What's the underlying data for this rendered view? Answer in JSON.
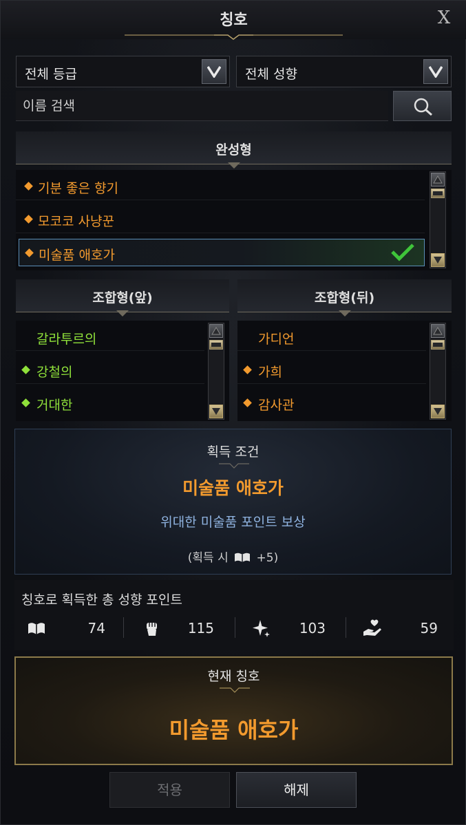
{
  "window": {
    "title": "칭호",
    "close_label": "X"
  },
  "filters": {
    "grade": {
      "selected": "전체 등급"
    },
    "tendency": {
      "selected": "전체 성향"
    }
  },
  "search": {
    "placeholder": "이름 검색"
  },
  "complete": {
    "header": "완성형",
    "items": [
      {
        "label": "기분 좋은 향기",
        "color": "#f29a2e",
        "bullet": true,
        "selected": false
      },
      {
        "label": "모코코 사냥꾼",
        "color": "#f29a2e",
        "bullet": true,
        "selected": false
      },
      {
        "label": "미술품 애호가",
        "color": "#f29a2e",
        "bullet": true,
        "selected": true
      }
    ]
  },
  "combo_front": {
    "header": "조합형(앞)",
    "items": [
      {
        "label": "갈라투르의",
        "bullet": false
      },
      {
        "label": "강철의",
        "bullet": true
      },
      {
        "label": "거대한",
        "bullet": true
      }
    ]
  },
  "combo_back": {
    "header": "조합형(뒤)",
    "items": [
      {
        "label": "가디언",
        "bullet": false
      },
      {
        "label": "가희",
        "bullet": true
      },
      {
        "label": "감사관",
        "bullet": true
      }
    ]
  },
  "acquisition": {
    "header": "획득 조건",
    "title_name": "미술품 애호가",
    "condition": "위대한 미술품 포인트 보상",
    "reward_prefix": "(획득 시",
    "reward_suffix": "+5)",
    "reward_icon": "book-icon"
  },
  "points": {
    "label": "칭호로 획득한 총 성향 포인트",
    "items": [
      {
        "icon": "book-icon",
        "value": "74"
      },
      {
        "icon": "fist-icon",
        "value": "115"
      },
      {
        "icon": "sparkle-icon",
        "value": "103"
      },
      {
        "icon": "heart-hand-icon",
        "value": "59"
      }
    ]
  },
  "current": {
    "header": "현재 칭호",
    "title_name": "미술품 애호가"
  },
  "buttons": {
    "apply": "적용",
    "release": "해제"
  },
  "colors": {
    "orange": "#f29a2e",
    "green": "#8fe03a",
    "check_green": "#3fc43a"
  }
}
